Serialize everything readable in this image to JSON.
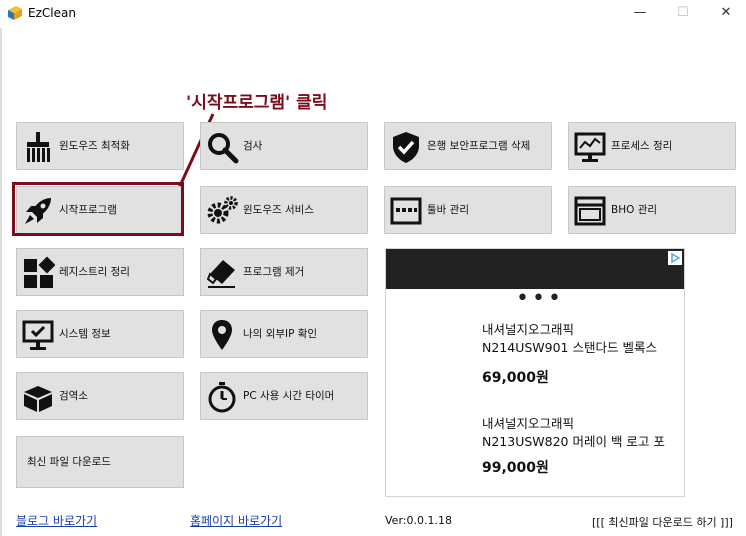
{
  "window": {
    "title": "EzClean"
  },
  "annotation": {
    "text": "'시작프로그램' 클릭"
  },
  "tiles": [
    {
      "label": "윈도우즈 최적화",
      "icon": "broom-icon"
    },
    {
      "label": "검사",
      "icon": "magnifier-icon"
    },
    {
      "label": "은행 보안프로그램 삭제",
      "icon": "shield-check-icon"
    },
    {
      "label": "프로세스 정리",
      "icon": "monitor-chart-icon"
    },
    {
      "label": "시작프로그램",
      "icon": "rocket-icon"
    },
    {
      "label": "윈도우즈 서비스",
      "icon": "gears-icon"
    },
    {
      "label": "툴바 관리",
      "icon": "toolbar-window-icon"
    },
    {
      "label": "BHO 관리",
      "icon": "browser-window-icon"
    },
    {
      "label": "레지스트리 정리",
      "icon": "registry-blocks-icon"
    },
    {
      "label": "프로그램 제거",
      "icon": "eraser-icon"
    },
    {
      "label": "시스템 정보",
      "icon": "monitor-check-icon"
    },
    {
      "label": "나의 외부IP 확인",
      "icon": "map-pin-icon"
    },
    {
      "label": "검역소",
      "icon": "box-icon"
    },
    {
      "label": "PC 사용 시간 타이머",
      "icon": "stopwatch-icon"
    },
    {
      "label": "최신 파일 다운로드",
      "icon": ""
    }
  ],
  "ad": {
    "items": [
      {
        "title_line1": "내셔널지오그래픽",
        "title_line2": "N214USW901 스탠다드 벨록스",
        "price": "69,000원"
      },
      {
        "title_line1": "내셔널지오그래픽",
        "title_line2": "N213USW820 머레이 백 로고 포",
        "price": "99,000원"
      }
    ]
  },
  "footer": {
    "blog_link": "블로그 바로가기",
    "homepage_link": "홈페이지 바로가기",
    "version": "Ver:0.0.1.18",
    "latest_download": "[[[ 최신파일 다운로드 하기 ]]]"
  },
  "colors": {
    "annotation": "#7a0c1c",
    "tile_bg": "#e1e1e1",
    "link": "#1a3fa8"
  }
}
